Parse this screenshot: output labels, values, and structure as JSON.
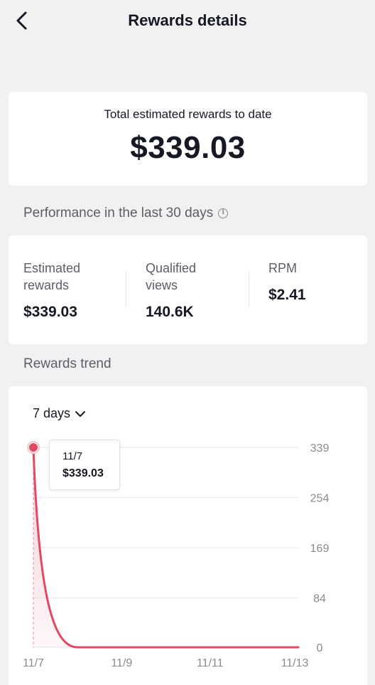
{
  "header": {
    "title": "Rewards details",
    "back_icon": "chevron-left-icon"
  },
  "total": {
    "label": "Total estimated rewards to date",
    "value": "$339.03"
  },
  "performance": {
    "title": "Performance in the last 30 days",
    "info_icon": "info-icon",
    "metrics": [
      {
        "label": "Estimated rewards",
        "value": "$339.03"
      },
      {
        "label": "Qualified views",
        "value": "140.6K"
      },
      {
        "label": "RPM",
        "value": "$2.41"
      }
    ]
  },
  "trend": {
    "title": "Rewards trend",
    "range": {
      "selected": "7 days",
      "icon": "chevron-down-icon"
    },
    "tooltip": {
      "date": "11/7",
      "value": "$339.03"
    }
  },
  "colors": {
    "accent": "#e04a63",
    "fill": "#f7c9d1",
    "grid": "#e6e6e8",
    "axis_text": "#8a8b91"
  },
  "chart_data": {
    "type": "area",
    "x": [
      "11/7",
      "11/8",
      "11/9",
      "11/10",
      "11/11",
      "11/12",
      "11/13"
    ],
    "x_tick_labels": [
      "11/7",
      "11/9",
      "11/11",
      "11/13"
    ],
    "y_tick_labels": [
      "339",
      "254",
      "169",
      "84",
      "0"
    ],
    "series": [
      {
        "values": [
          339.03,
          0,
          0,
          0,
          0,
          0,
          0
        ]
      }
    ],
    "ylim": [
      0,
      339
    ],
    "highlight": {
      "x": "11/7",
      "y": 339.03
    },
    "grid": true,
    "y_axis_side": "right"
  }
}
